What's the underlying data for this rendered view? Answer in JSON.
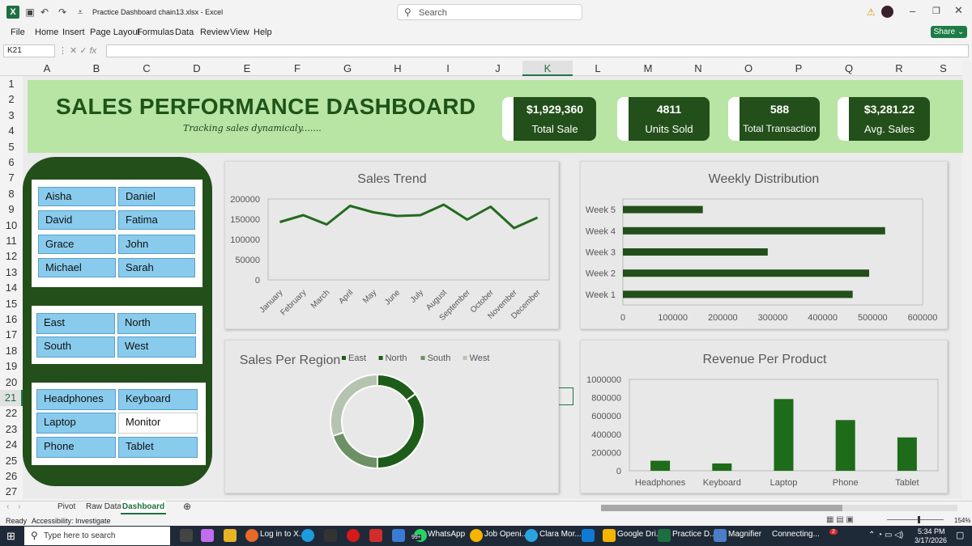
{
  "window": {
    "title": "Practice Dashboard chain13.xlsx - Excel",
    "search_placeholder": "Search",
    "share_label": "Share"
  },
  "menu": [
    "File",
    "Home",
    "Insert",
    "Page Layout",
    "Formulas",
    "Data",
    "Review",
    "View",
    "Help"
  ],
  "formula_bar": {
    "cell_ref": "K21",
    "fx": "fx",
    "value": ""
  },
  "columns": [
    "A",
    "B",
    "C",
    "D",
    "E",
    "F",
    "G",
    "H",
    "I",
    "J",
    "K",
    "L",
    "M",
    "N",
    "O",
    "P",
    "Q",
    "R",
    "S"
  ],
  "selected_column": "K",
  "rows": [
    "1",
    "2",
    "3",
    "4",
    "5",
    "6",
    "7",
    "8",
    "9",
    "10",
    "11",
    "12",
    "13",
    "14",
    "15",
    "16",
    "17",
    "18",
    "19",
    "20",
    "21",
    "22",
    "23",
    "24",
    "25",
    "26",
    "27"
  ],
  "selected_row": "21",
  "dashboard": {
    "title": "SALES PERFORMANCE DASHBOARD",
    "subtitle": "Tracking sales dynamicaly.......",
    "kpis": [
      {
        "value": "$1,929,360",
        "label": "Total Sale"
      },
      {
        "value": "4811",
        "label": "Units Sold"
      },
      {
        "value": "588",
        "label": "Total Transaction"
      },
      {
        "value": "$3,281.22",
        "label": "Avg. Sales"
      }
    ],
    "slicers": {
      "salespeople": [
        "Aisha",
        "Daniel",
        "David",
        "Fatima",
        "Grace",
        "John",
        "Michael",
        "Sarah"
      ],
      "regions": [
        "East",
        "North",
        "South",
        "West"
      ],
      "products": [
        "Headphones",
        "Keyboard",
        "Laptop",
        "Monitor",
        "Phone",
        "Tablet"
      ],
      "products_unselected": [
        "Monitor"
      ]
    }
  },
  "colors": {
    "dark_green": "#234f1a",
    "light_green": "#b8e4a4",
    "slicer_blue": "#89cbed",
    "line_green": "#236b1e"
  },
  "chart_data": [
    {
      "type": "line",
      "title": "Sales Trend",
      "categories": [
        "January",
        "February",
        "March",
        "April",
        "May",
        "June",
        "July",
        "August",
        "September",
        "October",
        "November",
        "December"
      ],
      "values": [
        143000,
        160000,
        137000,
        183000,
        167000,
        158000,
        160000,
        186000,
        149000,
        181000,
        128000,
        154000
      ],
      "ylim": [
        0,
        200000
      ],
      "yticks": [
        "200000",
        "150000",
        "100000",
        "50000",
        "0"
      ],
      "grid": false
    },
    {
      "type": "bar",
      "orientation": "horizontal",
      "title": "Weekly Distribution",
      "categories": [
        "Week 5",
        "Week 4",
        "Week 3",
        "Week 2",
        "Week 1"
      ],
      "values": [
        160000,
        525000,
        290000,
        493000,
        460000
      ],
      "xlim": [
        0,
        600000
      ],
      "xticks": [
        "0",
        "100000",
        "200000",
        "300000",
        "400000",
        "500000",
        "600000"
      ]
    },
    {
      "type": "pie",
      "title": "Sales Per Region",
      "categories": [
        "East",
        "North",
        "South",
        "West"
      ],
      "values": [
        15,
        35,
        20,
        30
      ],
      "colors": [
        "#1e5c1a",
        "#1e5c1a",
        "#6d9164",
        "#b5c4b0"
      ],
      "legend": "top-right"
    },
    {
      "type": "bar",
      "title": "Revenue Per Product",
      "categories": [
        "Headphones",
        "Keyboard",
        "Laptop",
        "Phone",
        "Tablet"
      ],
      "values": [
        110000,
        80000,
        785000,
        555000,
        365000
      ],
      "ylim": [
        0,
        1000000
      ],
      "yticks": [
        "1000000",
        "800000",
        "600000",
        "400000",
        "200000",
        "0"
      ]
    }
  ],
  "sheet_tabs": [
    "Pivot",
    "Raw Data",
    "Dashboard"
  ],
  "active_tab": "Dashboard",
  "status": {
    "ready": "Ready",
    "accessibility": "Accessibility: Investigate",
    "zoom": "154%"
  },
  "taskbar": {
    "search_placeholder": "Type here to search",
    "apps": [
      "Log in to X...",
      "WhatsApp",
      "Job Openi...",
      "Clara Mor...",
      "Google Dri...",
      "Practice D...",
      "Magnifier",
      "Connecting..."
    ],
    "time": "5:34 PM",
    "date": "3/17/2026",
    "whatsapp_badge": "99+",
    "notify_badge": "2"
  }
}
